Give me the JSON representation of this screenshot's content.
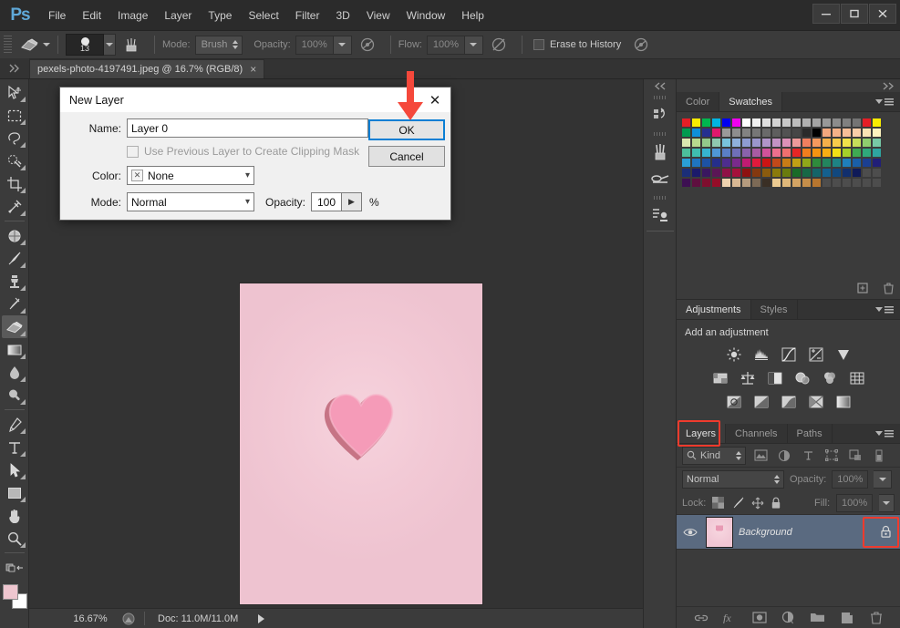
{
  "app": {
    "logo": "Ps",
    "menus": [
      "File",
      "Edit",
      "Image",
      "Layer",
      "Type",
      "Select",
      "Filter",
      "3D",
      "View",
      "Window",
      "Help"
    ],
    "window_controls": [
      "minimize",
      "maximize",
      "close"
    ]
  },
  "options_bar": {
    "tool_icon": "eraser-icon",
    "brush_size": "13",
    "mode_label": "Mode:",
    "mode_value": "Brush",
    "opacity_label": "Opacity:",
    "opacity_value": "100%",
    "flow_label": "Flow:",
    "flow_value": "100%",
    "erase_to_history_label": "Erase to History"
  },
  "document": {
    "tab_title": "pexels-photo-4197491.jpeg @ 16.7% (RGB/8)",
    "close_glyph": "×"
  },
  "toolbar": {
    "tools": [
      {
        "name": "move-tool",
        "active": false
      },
      {
        "name": "rectangular-marquee-tool",
        "active": false
      },
      {
        "name": "lasso-tool",
        "active": false
      },
      {
        "name": "quick-selection-tool",
        "active": false
      },
      {
        "name": "crop-tool",
        "active": false
      },
      {
        "name": "eyedropper-tool",
        "active": false
      },
      {
        "name": "spot-healing-brush-tool",
        "active": false
      },
      {
        "name": "brush-tool",
        "active": false
      },
      {
        "name": "clone-stamp-tool",
        "active": false
      },
      {
        "name": "history-brush-tool",
        "active": false
      },
      {
        "name": "eraser-tool",
        "active": true
      },
      {
        "name": "gradient-tool",
        "active": false
      },
      {
        "name": "blur-tool",
        "active": false
      },
      {
        "name": "dodge-tool",
        "active": false
      },
      {
        "name": "pen-tool",
        "active": false
      },
      {
        "name": "horizontal-type-tool",
        "active": false
      },
      {
        "name": "path-selection-tool",
        "active": false
      },
      {
        "name": "rectangle-tool",
        "active": false
      },
      {
        "name": "hand-tool",
        "active": false
      },
      {
        "name": "zoom-tool",
        "active": false
      }
    ],
    "foreground_color": "#eec6cf",
    "background_color": "#ffffff"
  },
  "dialog": {
    "title": "New Layer",
    "close_glyph": "✕",
    "name_label": "Name:",
    "name_value": "Layer 0",
    "clipping_mask_label": "Use Previous Layer to Create Clipping Mask",
    "clipping_mask_checked": false,
    "color_label": "Color:",
    "color_value": "None",
    "color_swatch_glyph": "✕",
    "mode_label": "Mode:",
    "mode_value": "Normal",
    "opacity_label": "Opacity:",
    "opacity_value": "100",
    "percent_symbol": "%",
    "ok_label": "OK",
    "cancel_label": "Cancel",
    "ok_highlight_color": "#0a7fd4",
    "annotation_arrow_color": "#f5483b"
  },
  "status_bar": {
    "zoom": "16.67%",
    "doc_info": "Doc: 11.0M/11.0M"
  },
  "rail": {
    "buttons": [
      "history-icon",
      "brushes-icon",
      "tool-presets-icon",
      "actions-icon"
    ]
  },
  "color_panel": {
    "tabs": [
      {
        "label": "Color",
        "active": false
      },
      {
        "label": "Swatches",
        "active": true
      }
    ],
    "swatches": [
      "#e41e26",
      "#f8ec00",
      "#00b64f",
      "#00b5e2",
      "#0000f0",
      "#ef00ef",
      "#ffffff",
      "#f0f0f0",
      "#e0e0e0",
      "#d4d4d4",
      "#c8c8c8",
      "#bcbcbc",
      "#b0b0b0",
      "#a4a4a4",
      "#989898",
      "#8c8c8c",
      "#808080",
      "#747474",
      "#e41e26",
      "#f8ec00",
      "#009b4f",
      "#0f8fd8",
      "#25308f",
      "#e0186c",
      "#9a9a9a",
      "#8e8e8e",
      "#828282",
      "#767676",
      "#6a6a6a",
      "#5e5e5e",
      "#525252",
      "#464646",
      "#2a2a2a",
      "#000000",
      "#f2a77e",
      "#f5b288",
      "#f6be98",
      "#f8cda8",
      "#fae3b4",
      "#fdf3bf",
      "#dbe8b0",
      "#b7d98e",
      "#93c98b",
      "#8fc8b0",
      "#79c3dd",
      "#8fb0dc",
      "#8e9cd2",
      "#9b96cc",
      "#b195c9",
      "#c493c4",
      "#dd91b8",
      "#ee9a9a",
      "#f27f5f",
      "#f49a5e",
      "#f5b04a",
      "#f7cc4b",
      "#f2e24a",
      "#c6de5a",
      "#8fce6e",
      "#77c9a6",
      "#4cbf9b",
      "#3fbdb0",
      "#36b4d0",
      "#4f97d6",
      "#5a7fc6",
      "#6f6fb8",
      "#8a62ab",
      "#a85ba2",
      "#d1529a",
      "#ef6f8d",
      "#ef6f6f",
      "#e52626",
      "#f07d1e",
      "#f59412",
      "#f6ae14",
      "#f2df16",
      "#a5d02a",
      "#3faa52",
      "#2fa87b",
      "#2ea5a0",
      "#2a9fd6",
      "#1f74c0",
      "#1d52a4",
      "#252e8b",
      "#4e2d8e",
      "#7a2a8c",
      "#c01b72",
      "#e01a3c",
      "#cc1414",
      "#c2491a",
      "#c87c16",
      "#bfa015",
      "#8fa81a",
      "#2f8b3c",
      "#23855e",
      "#1e8384",
      "#1f7fbb",
      "#1a5fa8",
      "#1b3f91",
      "#211f78",
      "#1b2e78",
      "#1b1a6b",
      "#3a1760",
      "#5b1656",
      "#8f1246",
      "#a5113b",
      "#8e1010",
      "#84380f",
      "#8a5b0e",
      "#8a7a0c",
      "#6a7b0e",
      "#196b28",
      "#176846",
      "#156468",
      "#14608e",
      "#11487e",
      "#112f6d",
      "#0f1a58",
      "#4d4d4d",
      "#4d4d4d",
      "#3d1052",
      "#5f0f3f",
      "#7e0e2e",
      "#950d28",
      "#eed2af",
      "#d9b894",
      "#b59b7e",
      "#7d6a56",
      "#3a2f25",
      "#eccb92",
      "#e0b87a",
      "#d3a464",
      "#c58e4a",
      "#b7762f",
      "#4d4d4d",
      "#4d4d4d",
      "#4d4d4d",
      "#4d4d4d",
      "#4d4d4d",
      "#4d4d4d"
    ]
  },
  "adjustments_panel": {
    "tabs": [
      {
        "label": "Adjustments",
        "active": true
      },
      {
        "label": "Styles",
        "active": false
      }
    ],
    "heading": "Add an adjustment",
    "rows": [
      [
        "brightness-contrast-icon",
        "levels-icon",
        "curves-icon",
        "exposure-icon",
        "vibrance-icon"
      ],
      [
        "hue-saturation-icon",
        "color-balance-icon",
        "black-white-icon",
        "photo-filter-icon",
        "channel-mixer-icon",
        "color-lookup-icon"
      ],
      [
        "invert-icon",
        "posterize-icon",
        "threshold-icon",
        "gradient-map-icon",
        "selective-color-icon"
      ]
    ]
  },
  "layers_panel": {
    "tabs": [
      {
        "label": "Layers",
        "active": true,
        "highlighted": true
      },
      {
        "label": "Channels",
        "active": false,
        "highlighted": false
      },
      {
        "label": "Paths",
        "active": false,
        "highlighted": false
      }
    ],
    "filter_label": "Kind",
    "filter_icons": [
      "pixel-layer-filter-icon",
      "adjustment-layer-filter-icon",
      "type-layer-filter-icon",
      "shape-layer-filter-icon",
      "smart-object-filter-icon",
      "filter-toggle-icon"
    ],
    "blend_mode": "Normal",
    "opacity_label": "Opacity:",
    "opacity_value": "100%",
    "lock_label": "Lock:",
    "lock_icons": [
      "lock-transparent-pixels-icon",
      "lock-image-pixels-icon",
      "lock-position-icon",
      "lock-all-icon"
    ],
    "fill_label": "Fill:",
    "fill_value": "100%",
    "layers": [
      {
        "name": "Background",
        "visible": true,
        "locked": true,
        "selected": true
      }
    ],
    "lock_highlight_color": "#ef3b2d",
    "bottom_buttons": [
      "link-layers-icon",
      "layer-style-icon",
      "layer-mask-icon",
      "new-fill-adjustment-icon",
      "new-group-icon",
      "new-layer-icon",
      "delete-layer-icon"
    ]
  },
  "canvas": {
    "image_alt": "pink-heart-photo",
    "background_color": "#f2c9d5",
    "heart_color": "#f29ab8"
  }
}
